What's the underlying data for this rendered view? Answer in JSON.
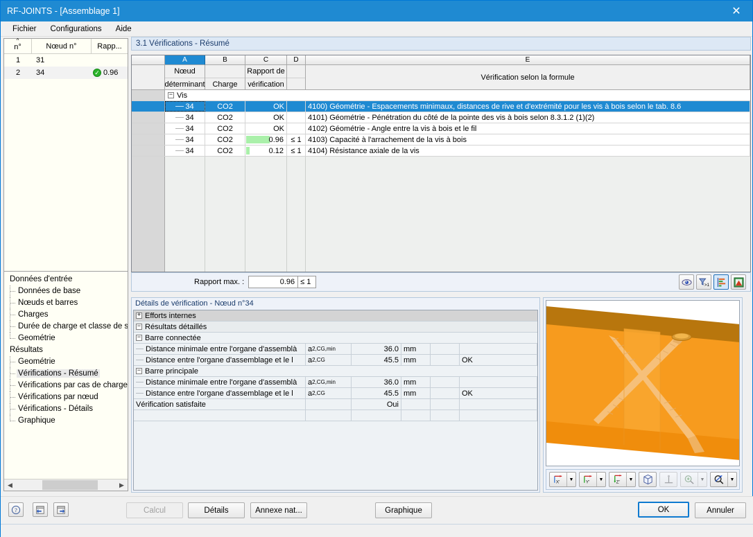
{
  "window": {
    "title": "RF-JOINTS - [Assemblage 1]",
    "close_label": "✕"
  },
  "menu": {
    "items": [
      "Fichier",
      "Configurations",
      "Aide"
    ]
  },
  "node_list": {
    "headers": [
      "n°",
      "Nœud n°",
      "Rapp..."
    ],
    "rows": [
      {
        "index": "1",
        "node": "31",
        "ratio": "",
        "ok": false
      },
      {
        "index": "2",
        "node": "34",
        "ratio": "0.96",
        "ok": true
      }
    ]
  },
  "tree": {
    "groups": [
      {
        "label": "Données d'entrée",
        "children": [
          "Données de base",
          "Nœuds et barres",
          "Charges",
          "Durée de charge et classe de s",
          "Geométrie"
        ]
      },
      {
        "label": "Résultats",
        "children": [
          "Geométrie",
          "Vérifications - Résumé",
          "Vérifications par cas de charge",
          "Vérifications par nœud",
          "Vérifications - Détails",
          "Graphique"
        ]
      }
    ],
    "active": "Vérifications - Résumé"
  },
  "section": {
    "title": "3.1 Vérifications - Résumé"
  },
  "results_table": {
    "column_letters": [
      "A",
      "B",
      "C",
      "D",
      "E"
    ],
    "selected_column": "A",
    "headers": {
      "a_top": "Nœud",
      "a_bottom": "déterminant",
      "b_bottom": "Charge",
      "c_top": "Rapport de",
      "c_bottom": "vérification",
      "e": "Vérification selon la formule"
    },
    "group_label": "Vis",
    "rows": [
      {
        "node": "34",
        "load": "CO2",
        "ratio": "OK",
        "cmp": "",
        "bar_pct": 0,
        "formula": "4100) Géométrie - Espacements minimaux, distances de rive et d'extrémité pour les vis à bois selon le tab. 8.6",
        "selected": true
      },
      {
        "node": "34",
        "load": "CO2",
        "ratio": "OK",
        "cmp": "",
        "bar_pct": 0,
        "formula": "4101) Géométrie -  Pénétration du côté de la pointe des vis à bois selon 8.3.1.2 (1)(2)",
        "selected": false
      },
      {
        "node": "34",
        "load": "CO2",
        "ratio": "OK",
        "cmp": "",
        "bar_pct": 0,
        "formula": "4102) Géométrie - Angle entre la vis à bois et le fil",
        "selected": false
      },
      {
        "node": "34",
        "load": "CO2",
        "ratio": "0.96",
        "cmp": "≤ 1",
        "bar_pct": 60,
        "formula": "4103) Capacité à l'arrachement de la vis à bois",
        "selected": false
      },
      {
        "node": "34",
        "load": "CO2",
        "ratio": "0.12",
        "cmp": "≤ 1",
        "bar_pct": 8,
        "formula": "4104) Résistance axiale de la vis",
        "selected": false
      }
    ]
  },
  "ratio_strip": {
    "label": "Rapport max. :",
    "value": "0.96",
    "comparison": "≤ 1",
    "buttons": [
      {
        "name": "view-result-icon",
        "title": "Afficher"
      },
      {
        "name": "filter-greater-than-one-icon",
        "title": "Filtre > 1"
      },
      {
        "name": "sort-bars-icon",
        "title": "Trier"
      },
      {
        "name": "excel-export-icon",
        "title": "Exporter Excel"
      }
    ]
  },
  "details": {
    "title": "Détails de vérification - Nœud n°34",
    "rows": [
      {
        "level": 0,
        "expander": "+",
        "label": "Efforts internes",
        "sym": "",
        "symsub": "",
        "val": "",
        "unit": "",
        "x": "",
        "ok": "",
        "span": true
      },
      {
        "level": 0,
        "expander": "−",
        "label": "Résultats détaillés",
        "sym": "",
        "symsub": "",
        "val": "",
        "unit": "",
        "x": "",
        "ok": "",
        "span": true
      },
      {
        "level": 1,
        "expander": "−",
        "label": "Barre connectée",
        "sym": "",
        "symsub": "",
        "val": "",
        "unit": "",
        "x": "",
        "ok": "",
        "span": true
      },
      {
        "level": 2,
        "expander": "",
        "label": "Distance minimale entre l'organe d'assemblà",
        "sym": "a",
        "symsub": "2,CG,min",
        "val": "36.0",
        "unit": "mm",
        "x": "",
        "ok": "",
        "span": false
      },
      {
        "level": 2,
        "expander": "",
        "label": "Distance entre l'organe d'assemblage et le l",
        "sym": "a",
        "symsub": "2,CG",
        "val": "45.5",
        "unit": "mm",
        "x": "",
        "ok": "OK",
        "span": false
      },
      {
        "level": 1,
        "expander": "−",
        "label": "Barre principale",
        "sym": "",
        "symsub": "",
        "val": "",
        "unit": "",
        "x": "",
        "ok": "",
        "span": true
      },
      {
        "level": 2,
        "expander": "",
        "label": "Distance minimale entre l'organe d'assemblà",
        "sym": "a",
        "symsub": "2,CG,min",
        "val": "36.0",
        "unit": "mm",
        "x": "",
        "ok": "",
        "span": false
      },
      {
        "level": 2,
        "expander": "",
        "label": "Distance entre l'organe d'assemblage et le l",
        "sym": "a",
        "symsub": "2,CG",
        "val": "45.5",
        "unit": "mm",
        "x": "",
        "ok": "OK",
        "span": false
      },
      {
        "level": 1,
        "expander": "",
        "label": "Vérification satisfaite",
        "sym": "",
        "symsub": "",
        "val": "Oui",
        "unit": "",
        "x": "",
        "ok": "",
        "span": false
      }
    ]
  },
  "viewport": {
    "render": "3D d'assemblage bois avec vis croisées",
    "colors": {
      "member_face": "#f79b1e",
      "member_top": "#b8760d",
      "member_side": "#f59000",
      "screw": "#f6c07a"
    },
    "toolbar": [
      {
        "name": "view-x-axis-icon",
        "label": "X",
        "dropdown": true,
        "disabled": false
      },
      {
        "name": "view-y-axis-icon",
        "label": "Y",
        "dropdown": true,
        "disabled": false
      },
      {
        "name": "view-z-axis-icon",
        "label": "Z",
        "dropdown": true,
        "disabled": false
      },
      {
        "name": "isometric-cube-icon",
        "label": "",
        "dropdown": false,
        "disabled": false
      },
      {
        "name": "perpendicular-view-icon",
        "label": "",
        "dropdown": false,
        "disabled": true
      },
      {
        "name": "zoom-in-icon",
        "label": "",
        "dropdown": true,
        "disabled": true
      },
      {
        "name": "zoom-region-icon",
        "label": "",
        "dropdown": true,
        "disabled": false
      }
    ]
  },
  "bottom": {
    "icon_buttons": [
      {
        "name": "help-icon",
        "glyph": "?"
      },
      {
        "name": "previous-page-icon",
        "glyph": "◀"
      },
      {
        "name": "next-page-icon",
        "glyph": "▶"
      }
    ],
    "buttons": [
      {
        "name": "calcul-button",
        "label": "Calcul",
        "disabled": true
      },
      {
        "name": "details-button",
        "label": "Détails",
        "disabled": false
      },
      {
        "name": "annexe-nat-button",
        "label": "Annexe nat...",
        "disabled": false
      },
      {
        "name": "graphique-button",
        "label": "Graphique",
        "disabled": false
      }
    ],
    "ok_label": "OK",
    "cancel_label": "Annuler"
  }
}
